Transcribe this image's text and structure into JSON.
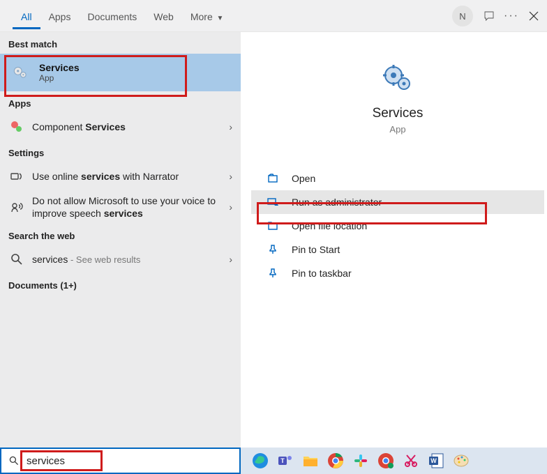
{
  "tabs": {
    "all": "All",
    "apps": "Apps",
    "docs": "Documents",
    "web": "Web",
    "more": "More"
  },
  "avatar": "N",
  "left": {
    "best_match_hdr": "Best match",
    "best_title": "Services",
    "best_sub": "App",
    "apps_hdr": "Apps",
    "apps_item_pre": "Component ",
    "apps_item_bold": "Services",
    "settings_hdr": "Settings",
    "set1_pre": "Use online ",
    "set1_bold": "services",
    "set1_post": " with Narrator",
    "set2_pre": "Do not allow Microsoft to use your voice to improve speech ",
    "set2_bold": "services",
    "web_hdr": "Search the web",
    "web_item": "services",
    "web_post": " - See web results",
    "docs_hdr": "Documents (1+)"
  },
  "right": {
    "title": "Services",
    "sub": "App",
    "open": "Open",
    "runadmin": "Run as administrator",
    "openloc": "Open file location",
    "pinstart": "Pin to Start",
    "pintask": "Pin to taskbar"
  },
  "search": "services"
}
